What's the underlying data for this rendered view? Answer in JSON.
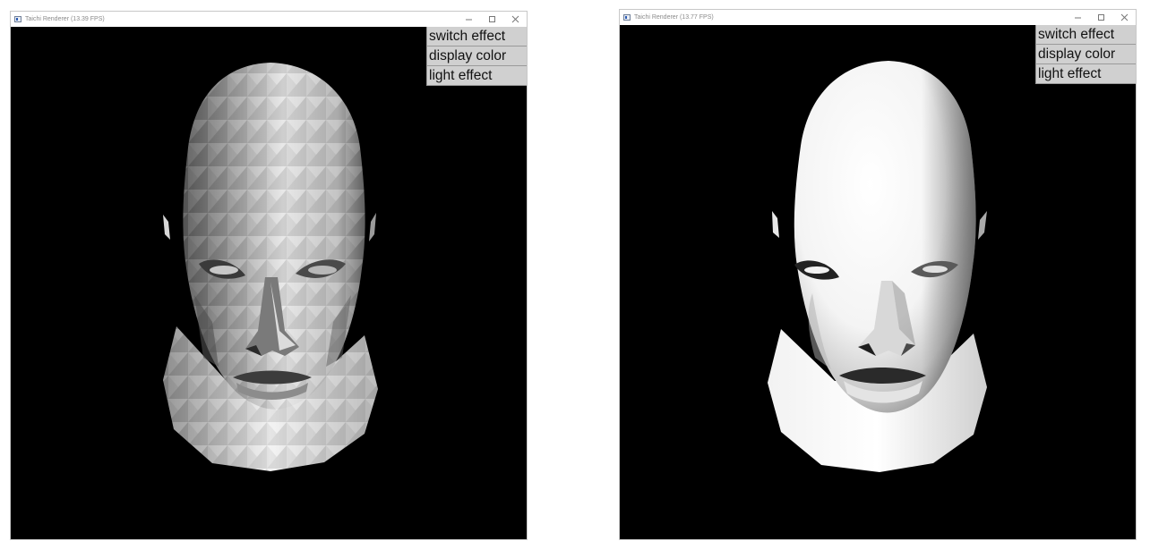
{
  "windows": [
    {
      "title": "Taichi Renderer (13.39 FPS)",
      "shading": "flat",
      "menu": [
        "switch effect",
        "display color",
        "light effect"
      ]
    },
    {
      "title": "Taichi Renderer (13.77 FPS)",
      "shading": "smooth",
      "menu": [
        "switch effect",
        "display color",
        "light effect"
      ]
    }
  ],
  "window_controls": {
    "minimize": "minimize-icon",
    "maximize": "maximize-icon",
    "close": "close-icon"
  },
  "colors": {
    "viewport_bg": "#000000",
    "menu_bg": "#d0d0d0"
  }
}
